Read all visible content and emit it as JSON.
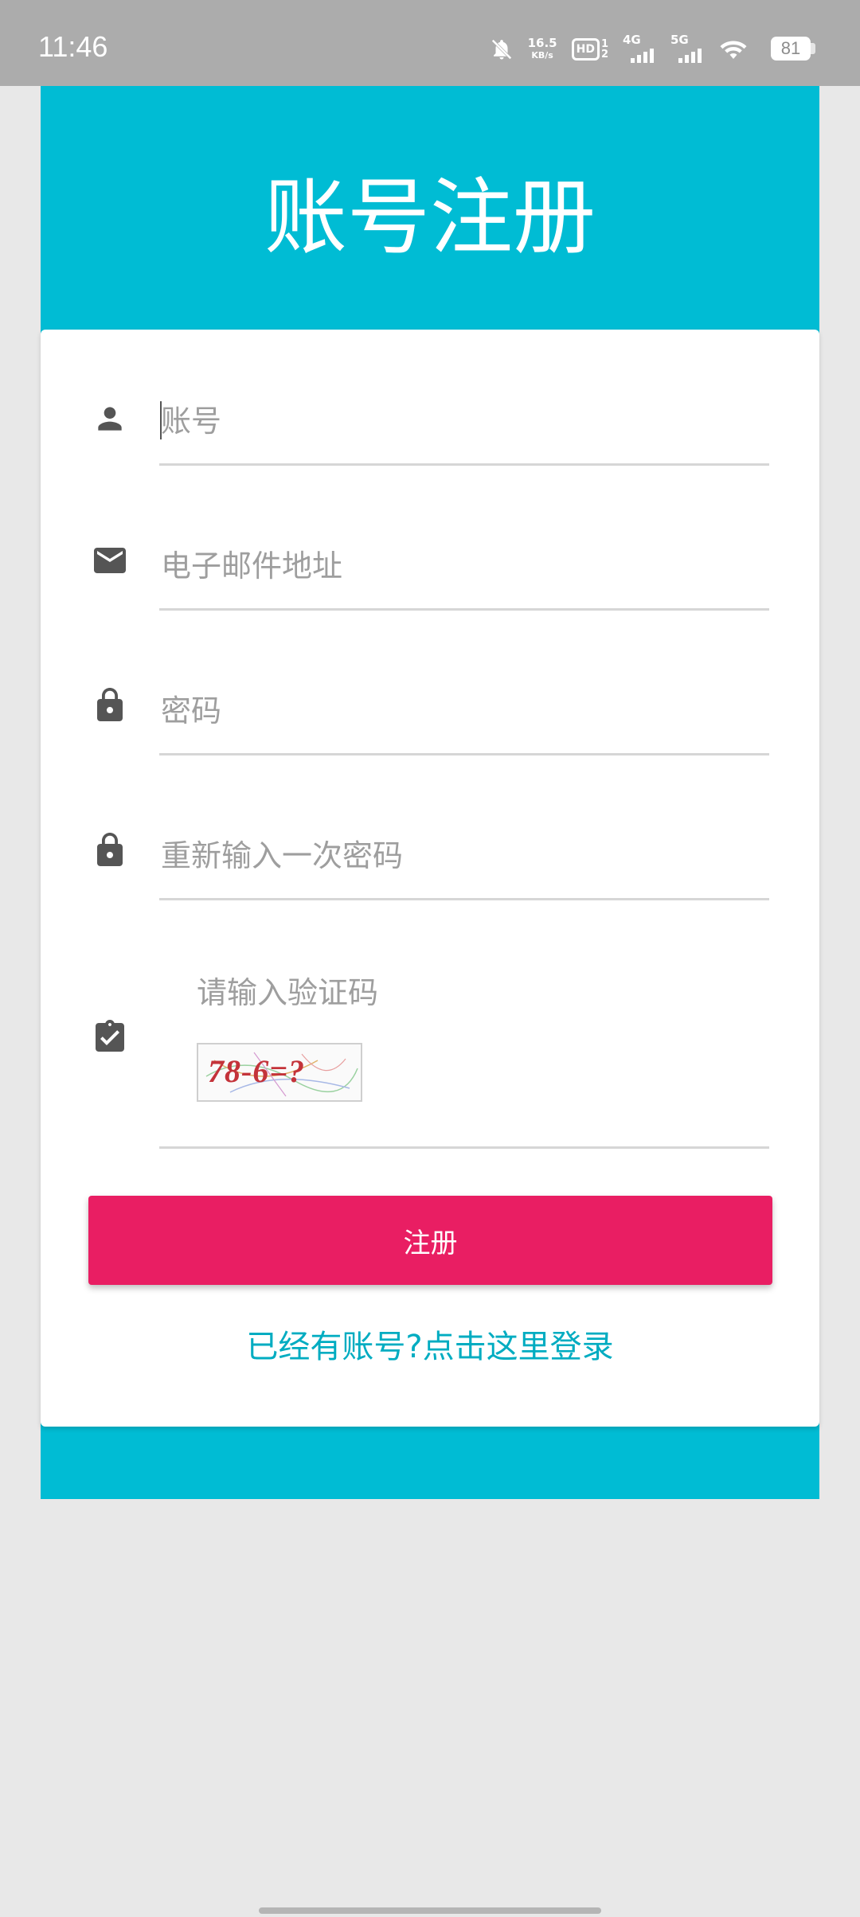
{
  "status_bar": {
    "time": "11:46",
    "net_speed": "16.5",
    "net_speed_unit": "KB/s",
    "hd_label": "HD",
    "hd_digits": [
      "1",
      "2"
    ],
    "sim1_label": "4G",
    "sim2_label": "5G",
    "battery": "81"
  },
  "header": {
    "title": "账号注册"
  },
  "form": {
    "account_placeholder": "账号",
    "email_placeholder": "电子邮件地址",
    "password_placeholder": "密码",
    "confirm_password_placeholder": "重新输入一次密码",
    "captcha_label": "请输入验证码",
    "captcha_text": "78-6=?",
    "submit_label": "注册",
    "login_link": "已经有账号?点击这里登录"
  },
  "colors": {
    "header": "#00bcd4",
    "button": "#e91e63",
    "link": "#00acc1",
    "icon": "#555555"
  }
}
